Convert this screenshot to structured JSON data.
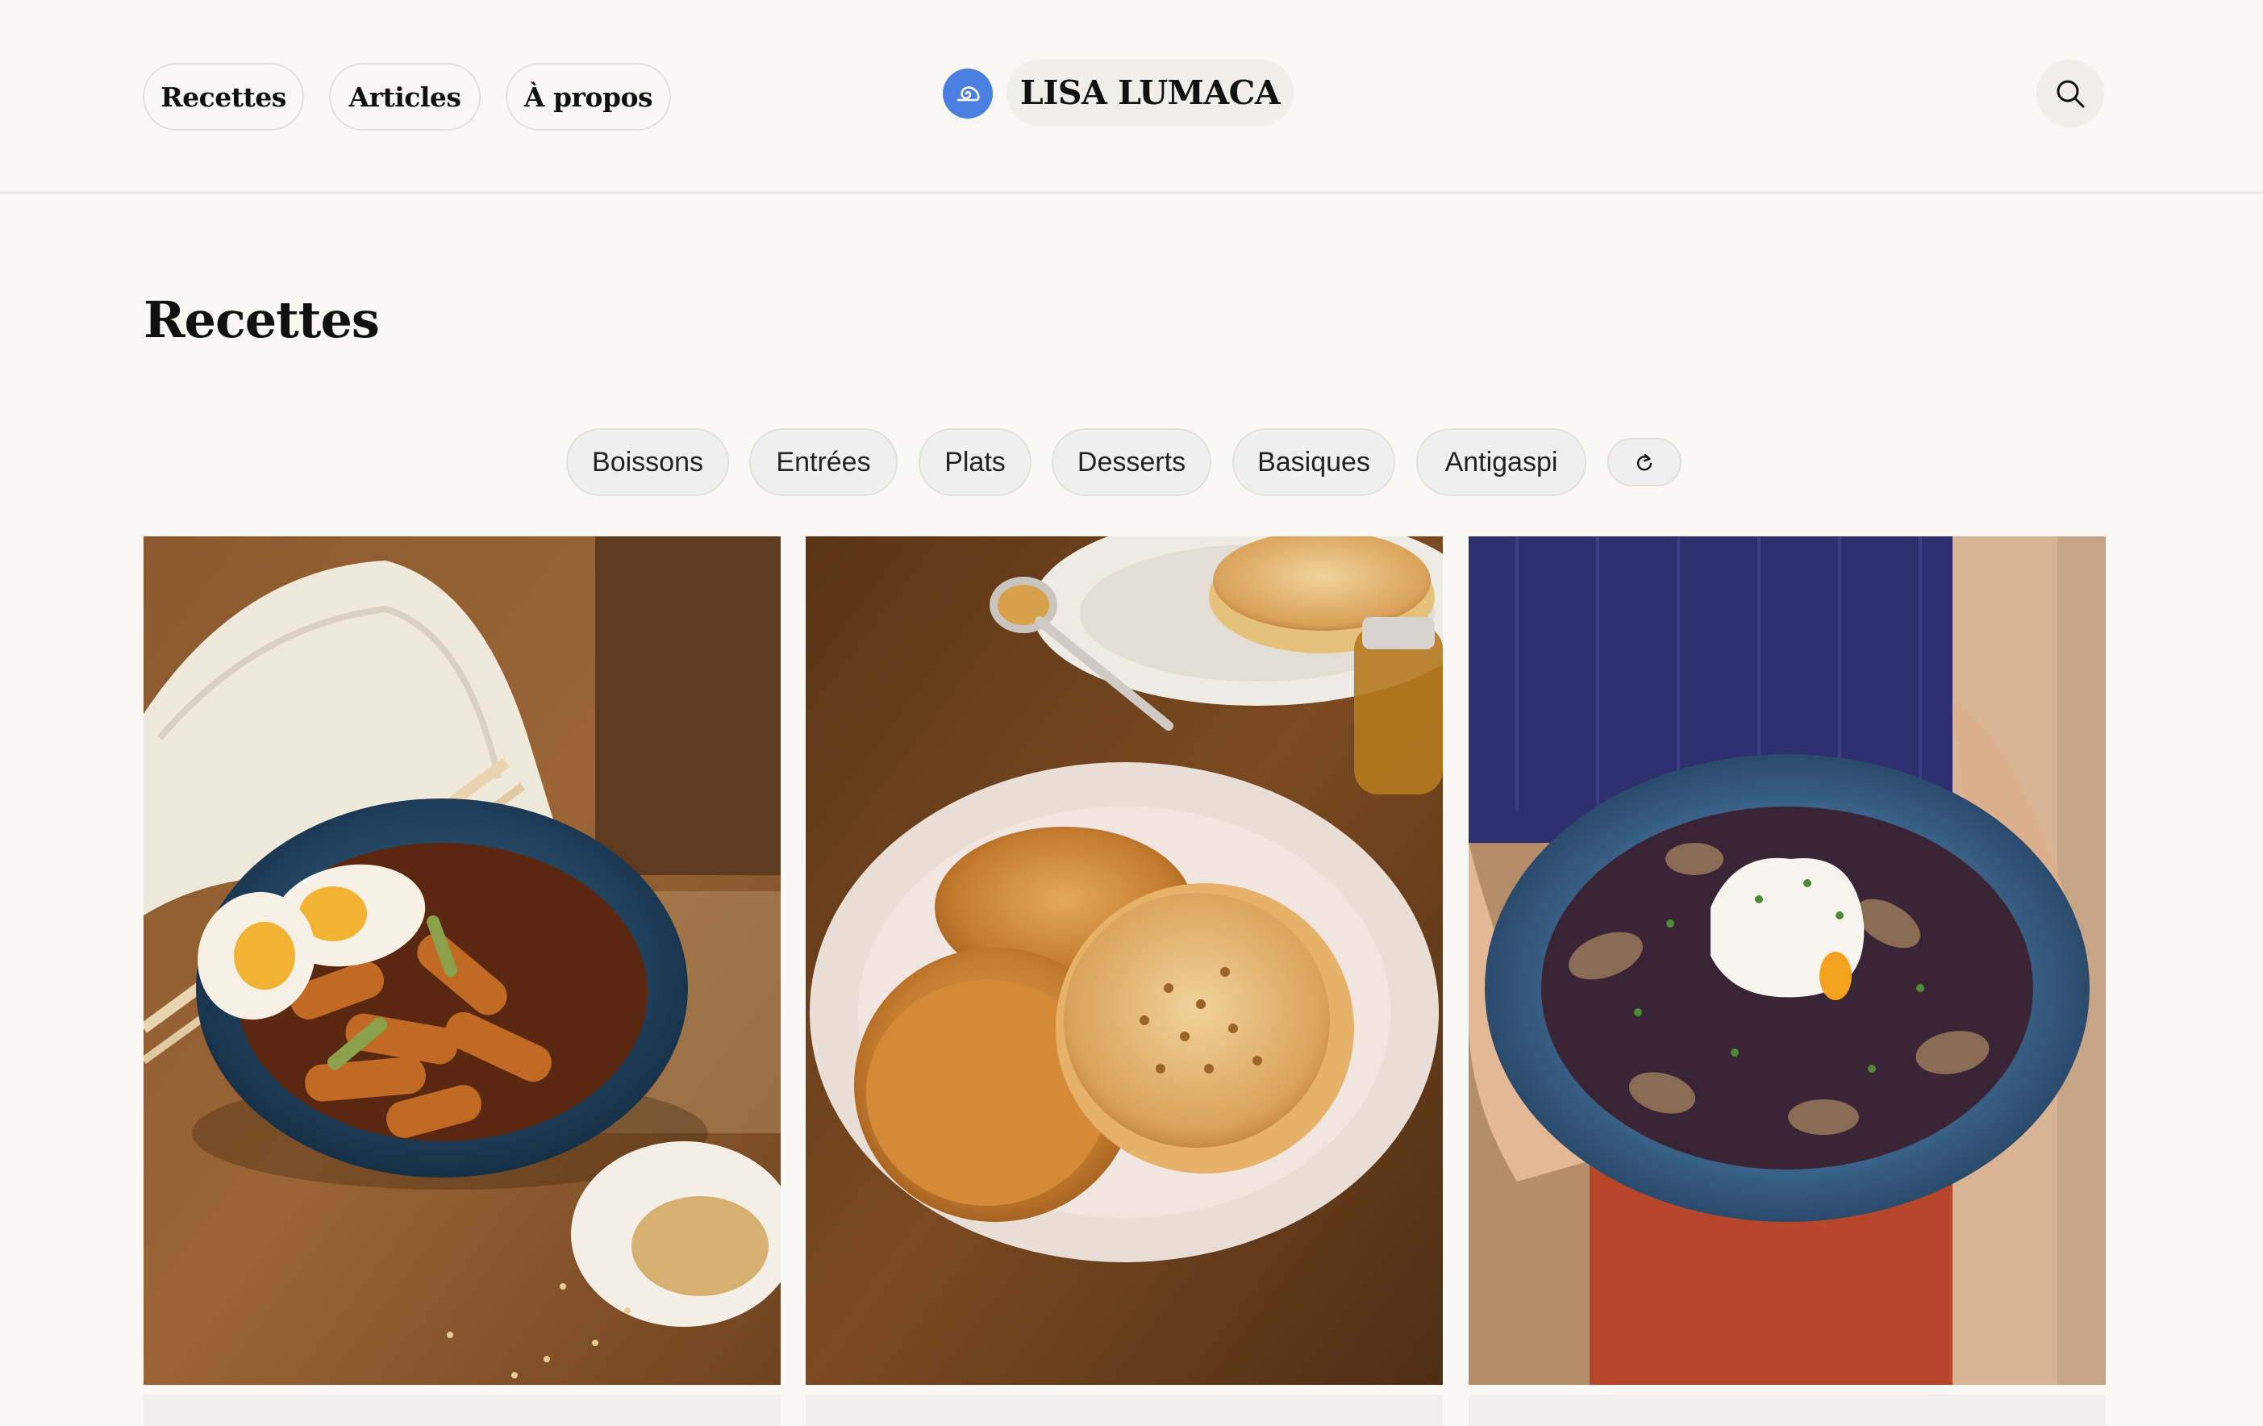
{
  "header": {
    "nav": [
      {
        "label": "Recettes"
      },
      {
        "label": "Articles"
      },
      {
        "label": "À propos"
      }
    ],
    "brand": "LISA LUMACA",
    "logo_icon": "snail-spiral-icon",
    "search_icon": "search-icon",
    "accent_color": "#4a7fe0"
  },
  "main": {
    "title": "Recettes",
    "filters": [
      {
        "label": "Boissons"
      },
      {
        "label": "Entrées"
      },
      {
        "label": "Plats"
      },
      {
        "label": "Desserts"
      },
      {
        "label": "Basiques"
      },
      {
        "label": "Antigaspi"
      }
    ],
    "reset_icon": "reset-icon"
  },
  "cards": [
    {
      "image": "tteokbokki-bowl-with-eggs-photo"
    },
    {
      "image": "crumpets-on-plate-photo"
    },
    {
      "image": "mushroom-stew-with-poached-egg-photo"
    }
  ]
}
